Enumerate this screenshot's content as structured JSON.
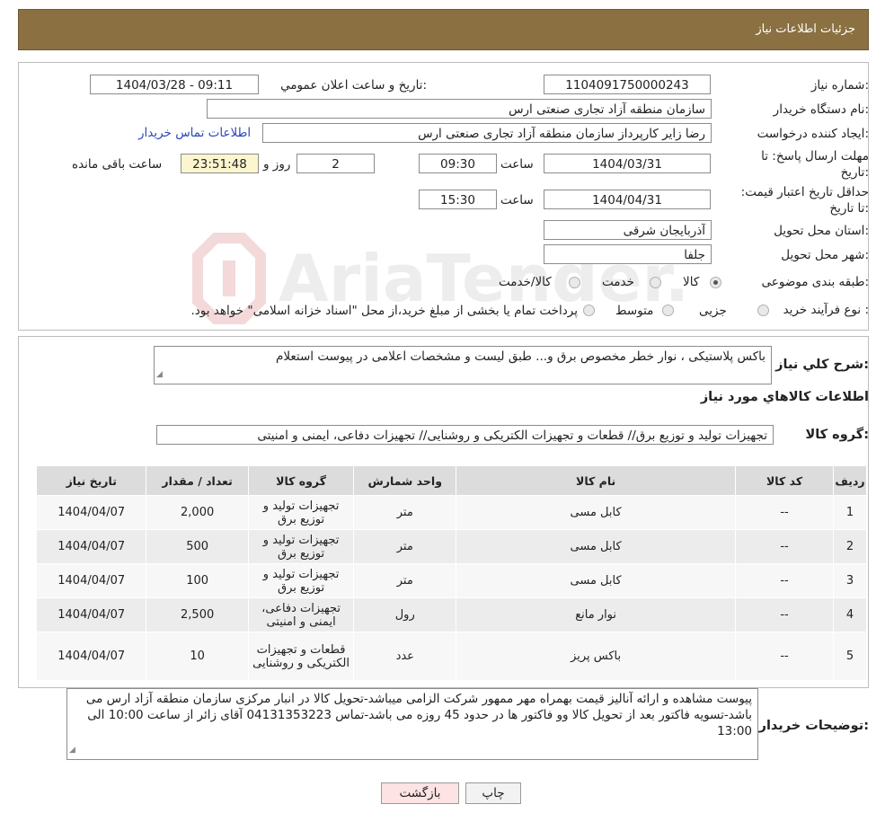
{
  "header": {
    "title": "جزئیات اطلاعات نیاز"
  },
  "form": {
    "need_number_label": "شماره نیاز:",
    "need_number": "1104091750000243",
    "announce_label": "تاریخ و ساعت اعلان عمومي:",
    "announce_value": "1404/03/28 - 09:11",
    "buyer_label": "نام دستگاه خریدار:",
    "buyer_value": "سازمان منطقه آزاد تجاری صنعتی ارس",
    "creator_label": "ایجاد کننده درخواست:",
    "creator_value": "رضا زایر کارپرداز سازمان منطقه آزاد تجاری صنعتی ارس",
    "contact_link": "اطلاعات تماس خریدار",
    "deadline_label": "مهلت ارسال پاسخ: تا تاریخ:",
    "deadline_date": "1404/03/31",
    "time_label": "ساعت",
    "deadline_time": "09:30",
    "days_value": "2",
    "days_label": "روز و",
    "remaining_time": "23:51:48",
    "remaining_label": "ساعت باقی مانده",
    "validity_label": "حداقل تاریخ اعتبار قیمت: تا تاریخ:",
    "validity_date": "1404/04/31",
    "validity_time": "15:30",
    "province_label": "استان محل تحویل:",
    "province_value": "آذربایجان شرقی",
    "city_label": "شهر محل تحویل:",
    "city_value": "جلفا",
    "category_label": "طبقه بندی موضوعی:",
    "category_options": [
      "کالا",
      "خدمت",
      "کالا/خدمت"
    ],
    "category_selected": "کالا",
    "process_label": "نوع فرآیند خرید :",
    "process_options": [
      "جزیی",
      "متوسط"
    ],
    "process_note": "پرداخت تمام یا بخشی از مبلغ خرید،از محل \"اسناد خزانه اسلامی\" خواهد بود."
  },
  "watermark": {
    "text": "AriaTender.neT"
  },
  "summary": {
    "label": "شرح کلي نیاز:",
    "value": "باکس پلاستیکی ، نوار خطر مخصوص برق و... طبق لیست و مشخصات اعلامی در پیوست استعلام",
    "goods_title": "اطلاعات کالاهاي مورد نیاز",
    "group_label": "گروه کالا:",
    "group_value": "تجهیزات تولید و توزیع برق// قطعات و تجهیزات الکتریکی و روشنایی// تجهیزات دفاعی، ایمنی و امنیتی"
  },
  "table": {
    "headers": [
      "ردیف",
      "کد کالا",
      "نام کالا",
      "واحد شمارش",
      "گروه کالا",
      "تعداد / مقدار",
      "تاریخ نیاز"
    ],
    "rows": [
      [
        "1",
        "--",
        "کابل مسی",
        "متر",
        "تجهیزات تولید و توزیع برق",
        "2,000",
        "1404/04/07"
      ],
      [
        "2",
        "--",
        "کابل مسی",
        "متر",
        "تجهیزات تولید و توزیع برق",
        "500",
        "1404/04/07"
      ],
      [
        "3",
        "--",
        "کابل مسی",
        "متر",
        "تجهیزات تولید و توزیع برق",
        "100",
        "1404/04/07"
      ],
      [
        "4",
        "--",
        "نوار مانع",
        "رول",
        "تجهیزات دفاعی، ایمنی و امنیتی",
        "2,500",
        "1404/04/07"
      ],
      [
        "5",
        "--",
        "باکس پریز",
        "عدد",
        "قطعات و تجهیزات الکتریکی و روشنایی",
        "10",
        "1404/04/07"
      ]
    ]
  },
  "notes": {
    "label": "توضیحات خریدار:",
    "value": "پیوست مشاهده و ارائه آنالیز قیمت بهمراه مهر ممهور شرکت الزامی میباشد-تحویل کالا در انبار مرکزی سازمان منطقه آزاد ارس می باشد-تسویه فاکتور بعد از تحویل کالا وو فاکتور ها در حدود 45 روزه می باشد-تماس 04131353223 آقای زائر از ساعت 10:00 الی 13:00"
  },
  "buttons": {
    "print": "چاپ",
    "back": "بازگشت"
  }
}
